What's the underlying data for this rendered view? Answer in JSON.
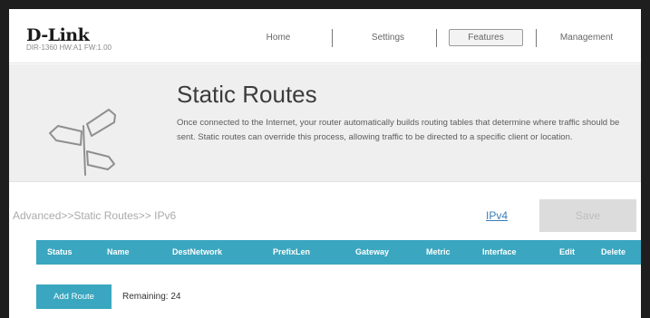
{
  "header": {
    "logo_text": "D-Link",
    "model_info": "DIR-1360 HW:A1 FW:1.00",
    "nav": {
      "home": "Home",
      "settings": "Settings",
      "features": "Features",
      "management": "Management"
    }
  },
  "banner": {
    "title": "Static Routes",
    "description": "Once connected to the Internet, your router automatically builds routing tables that determine where traffic should be sent. Static routes can override this process, allowing traffic to be directed to a specific client or location.",
    "icon": "signpost-icon"
  },
  "toolbar": {
    "breadcrumb": "Advanced>>Static Routes>> IPv6",
    "ipv4_link": "IPv4",
    "save_label": "Save"
  },
  "table": {
    "columns": [
      "Status",
      "Name",
      "DestNetwork",
      "PrefixLen",
      "Gateway",
      "Metric",
      "Interface",
      "Edit",
      "Delete"
    ],
    "rows": []
  },
  "footer": {
    "add_route_label": "Add Route",
    "remaining_label": "Remaining: 24"
  },
  "colors": {
    "accent": "#3aa6bf",
    "save_disabled_bg": "#dcdcdc",
    "banner_bg": "#efefef"
  }
}
